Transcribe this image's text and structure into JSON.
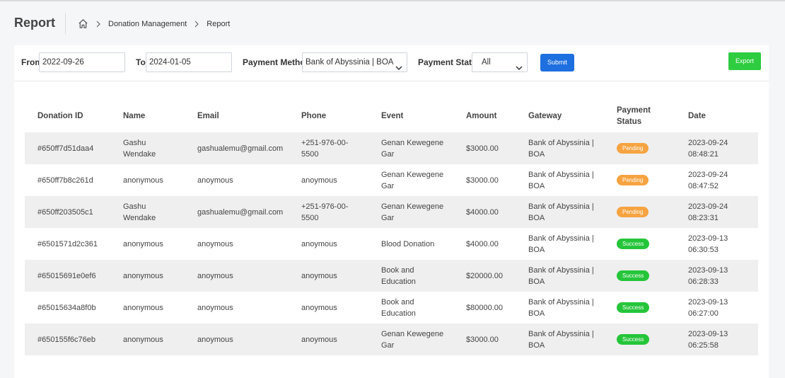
{
  "header": {
    "title": "Report",
    "breadcrumb": [
      "Donation Management",
      "Report"
    ]
  },
  "filters": {
    "from_label": "From",
    "from_value": "2022-09-26",
    "to_label": "To",
    "to_value": "2024-01-05",
    "method_label": "Payment Method",
    "method_value": "Bank of Abyssinia | BOA",
    "status_label": "Payment Status",
    "status_value": "All",
    "submit_label": "Submit",
    "export_label": "Export"
  },
  "table": {
    "headers": [
      "Donation ID",
      "Name",
      "Email",
      "Phone",
      "Event",
      "Amount",
      "Gateway",
      "Payment Status",
      "Date"
    ],
    "rows": [
      {
        "id": "#650ff7d51daa4",
        "name": "Gashu Wendake",
        "email": "gashualemu@gmail.com",
        "phone": "+251-976-00-5500",
        "event": "Genan Kewegene Gar",
        "amount": "$3000.00",
        "gateway": "Bank of Abyssinia | BOA",
        "status": "Pending",
        "date": "2023-09-24 08:48:21"
      },
      {
        "id": "#650ff7b8c261d",
        "name": "anonymous",
        "email": "anoymous",
        "phone": "anoymous",
        "event": "Genan Kewegene Gar",
        "amount": "$3000.00",
        "gateway": "Bank of Abyssinia | BOA",
        "status": "Pending",
        "date": "2023-09-24 08:47:52"
      },
      {
        "id": "#650ff203505c1",
        "name": "Gashu Wendake",
        "email": "gashualemu@gmail.com",
        "phone": "+251-976-00-5500",
        "event": "Genan Kewegene Gar",
        "amount": "$4000.00",
        "gateway": "Bank of Abyssinia | BOA",
        "status": "Pending",
        "date": "2023-09-24 08:23:31"
      },
      {
        "id": "#6501571d2c361",
        "name": "anonymous",
        "email": "anoymous",
        "phone": "anoymous",
        "event": "Blood Donation",
        "amount": "$4000.00",
        "gateway": "Bank of Abyssinia | BOA",
        "status": "Success",
        "date": "2023-09-13 06:30:53"
      },
      {
        "id": "#65015691e0ef6",
        "name": "anonymous",
        "email": "anoymous",
        "phone": "anoymous",
        "event": "Book and Education",
        "amount": "$20000.00",
        "gateway": "Bank of Abyssinia | BOA",
        "status": "Success",
        "date": "2023-09-13 06:28:33"
      },
      {
        "id": "#65015634a8f0b",
        "name": "anonymous",
        "email": "anoymous",
        "phone": "anoymous",
        "event": "Book and Education",
        "amount": "$80000.00",
        "gateway": "Bank of Abyssinia | BOA",
        "status": "Success",
        "date": "2023-09-13 06:27:00"
      },
      {
        "id": "#650155f6c76eb",
        "name": "anonymous",
        "email": "anoymous",
        "phone": "anoymous",
        "event": "Genan Kewegene Gar",
        "amount": "$3000.00",
        "gateway": "Bank of Abyssinia | BOA",
        "status": "Success",
        "date": "2023-09-13 06:25:58"
      }
    ]
  },
  "colors": {
    "submit": "#1e6fe0",
    "export": "#2ecc40",
    "pending": "#f7a341",
    "success": "#25c53a"
  },
  "icons": {
    "home": "home-icon",
    "breadcrumb_separator": "chevron-right-icon",
    "select_arrow": "chevron-down-icon"
  }
}
